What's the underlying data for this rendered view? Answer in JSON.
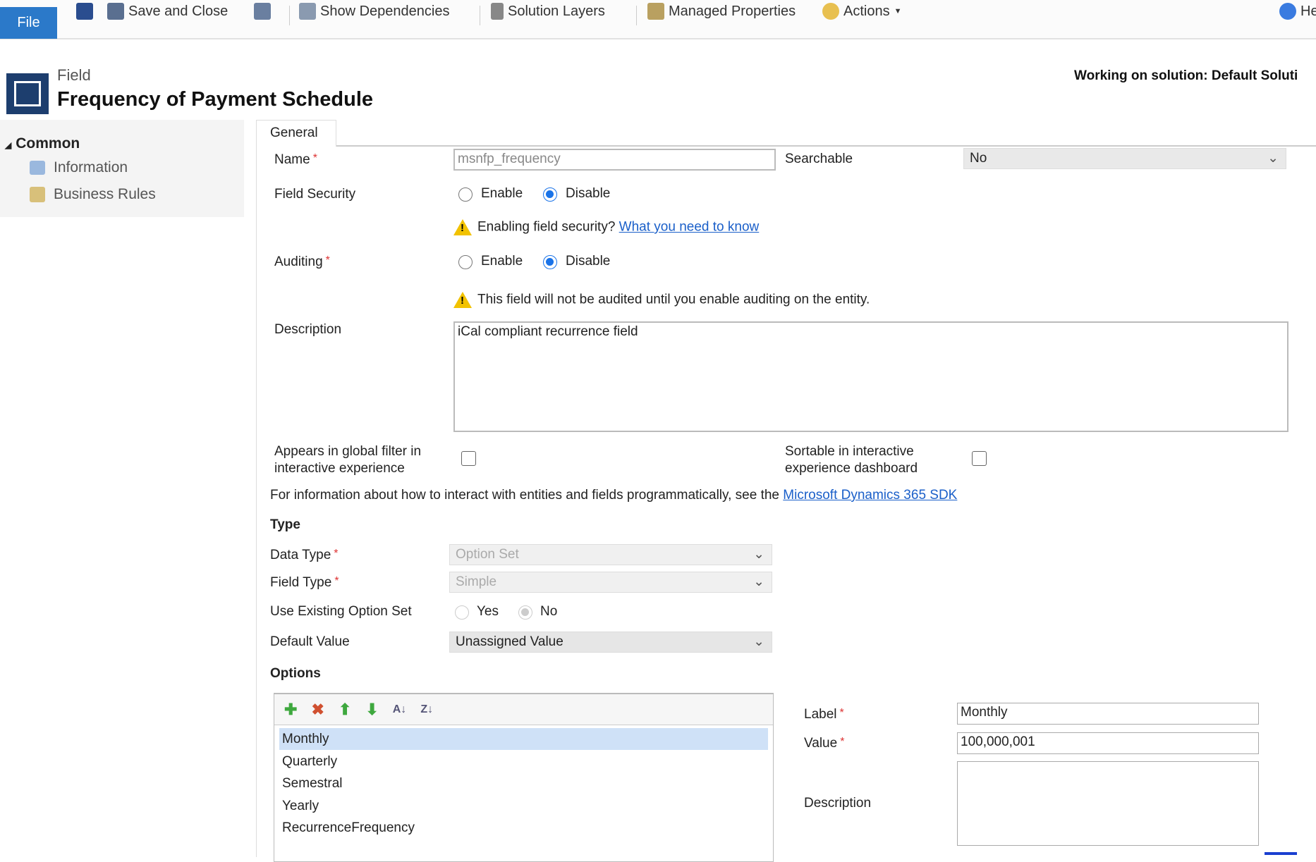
{
  "toolbar": {
    "file": "File",
    "save_close": "Save and Close",
    "show_dependencies": "Show Dependencies",
    "solution_layers": "Solution Layers",
    "managed_properties": "Managed Properties",
    "actions": "Actions",
    "help": "He"
  },
  "header": {
    "entity_type": "Field",
    "title": "Frequency of Payment Schedule",
    "solution": "Working on solution: Default Soluti"
  },
  "sidebar": {
    "group": "Common",
    "items": [
      {
        "label": "Information"
      },
      {
        "label": "Business Rules"
      }
    ]
  },
  "tabs": [
    {
      "label": "General"
    }
  ],
  "form": {
    "name_label": "Name",
    "name_value": "msnfp_frequency",
    "searchable_label": "Searchable",
    "searchable_value": "No",
    "field_security_label": "Field Security",
    "enable": "Enable",
    "disable": "Disable",
    "field_security_warning": "Enabling field security?",
    "field_security_link": "What you need to know",
    "auditing_label": "Auditing",
    "auditing_warning": "This field will not be audited until you enable auditing on the entity.",
    "description_label": "Description",
    "description_value": "iCal compliant recurrence field",
    "global_filter_label": "Appears in global filter in interactive experience",
    "sortable_label": "Sortable in interactive experience dashboard",
    "sdk_text": "For information about how to interact with entities and fields programmatically, see the",
    "sdk_link": "Microsoft Dynamics 365 SDK",
    "type_heading": "Type",
    "data_type_label": "Data Type",
    "data_type_value": "Option Set",
    "field_type_label": "Field Type",
    "field_type_value": "Simple",
    "use_existing_label": "Use Existing Option Set",
    "yes": "Yes",
    "no": "No",
    "default_value_label": "Default Value",
    "default_value_value": "Unassigned Value",
    "options_heading": "Options"
  },
  "options": {
    "items": [
      "Monthly",
      "Quarterly",
      "Semestral",
      "Yearly",
      "RecurrenceFrequency"
    ],
    "selected": "Monthly",
    "label_label": "Label",
    "label_value": "Monthly",
    "value_label": "Value",
    "value_value": "100,000,001",
    "description_label": "Description"
  },
  "colors": {
    "accent": "#2b79c9",
    "selected_row": "#cfe1f7",
    "link": "#1a5fc9"
  }
}
